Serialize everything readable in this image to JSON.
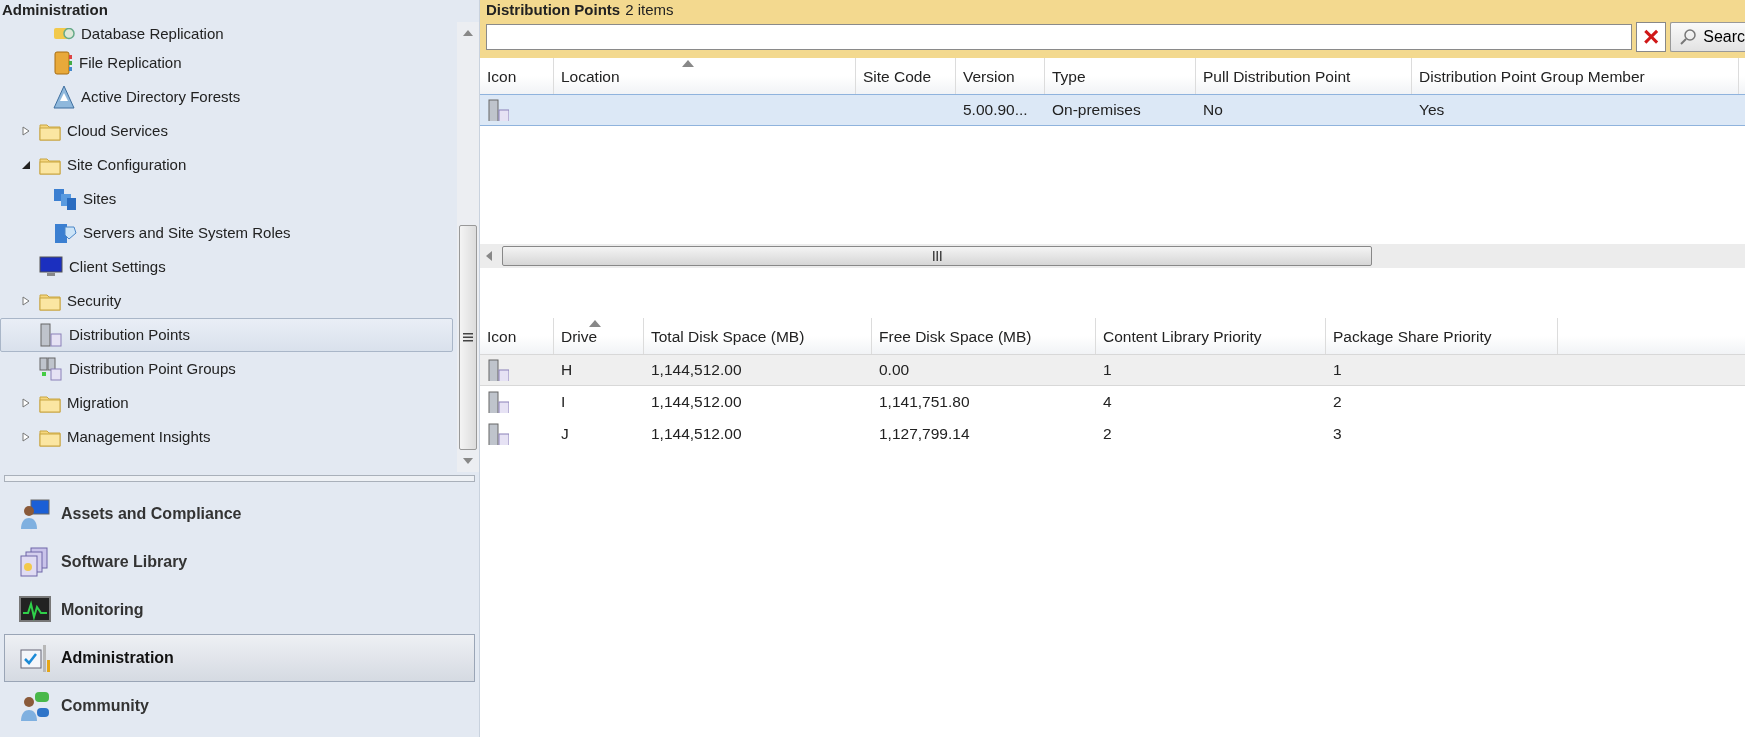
{
  "navigation_pane": {
    "title": "Administration",
    "tree": {
      "scrolled_branch_children": [
        {
          "label": "Database Replication",
          "kind": "database",
          "selected": false
        },
        {
          "label": "File Replication",
          "kind": "book",
          "selected": false
        },
        {
          "label": "Active Directory Forests",
          "kind": "triangle",
          "selected": false
        }
      ],
      "items": [
        {
          "label": "Cloud Services",
          "kind": "folder",
          "expanded": false,
          "selected": false
        },
        {
          "label": "Site Configuration",
          "kind": "folder",
          "expanded": true,
          "selected": false,
          "children": [
            {
              "label": "Sites",
              "kind": "sites",
              "selected": false
            },
            {
              "label": "Servers and Site System Roles",
              "kind": "roles",
              "selected": false
            }
          ]
        },
        {
          "label": "Client Settings",
          "kind": "monitor",
          "selected": false
        },
        {
          "label": "Security",
          "kind": "folder",
          "expanded": false,
          "selected": false
        },
        {
          "label": "Distribution Points",
          "kind": "server",
          "selected": true
        },
        {
          "label": "Distribution Point Groups",
          "kind": "server-group",
          "selected": false
        },
        {
          "label": "Migration",
          "kind": "folder",
          "expanded": false,
          "selected": false
        },
        {
          "label": "Management Insights",
          "kind": "folder",
          "expanded": false,
          "selected": false
        }
      ]
    },
    "workspaces": [
      {
        "label": "Assets and Compliance",
        "kind": "person-pc",
        "selected": false
      },
      {
        "label": "Software Library",
        "kind": "library",
        "selected": false
      },
      {
        "label": "Monitoring",
        "kind": "monitor-chart",
        "selected": false
      },
      {
        "label": "Administration",
        "kind": "admin",
        "selected": true
      },
      {
        "label": "Community",
        "kind": "community",
        "selected": false
      }
    ]
  },
  "results": {
    "title": "Distribution Points",
    "count": "2 items",
    "search": {
      "clear": "×",
      "button": "Searc"
    },
    "columns": [
      "Icon",
      "Location",
      "Site Code",
      "Version",
      "Type",
      "Pull Distribution Point",
      "Distribution Point Group Member"
    ],
    "rows": [
      {
        "version": "5.00.90...",
        "type": "On-premises",
        "pull": "No",
        "group_member": "Yes",
        "selected": true
      }
    ]
  },
  "details": {
    "columns": [
      "Icon",
      "Drive",
      "Total Disk Space (MB)",
      "Free Disk Space (MB)",
      "Content Library Priority",
      "Package Share Priority"
    ],
    "rows": [
      {
        "drive": "H",
        "total": "1,144,512.00",
        "free": "0.00",
        "content_priority": "1",
        "package_priority": "1",
        "selected": true
      },
      {
        "drive": "I",
        "total": "1,144,512.00",
        "free": "1,141,751.80",
        "content_priority": "4",
        "package_priority": "2",
        "selected": false
      },
      {
        "drive": "J",
        "total": "1,144,512.00",
        "free": "1,127,799.14",
        "content_priority": "2",
        "package_priority": "3",
        "selected": false
      }
    ]
  }
}
